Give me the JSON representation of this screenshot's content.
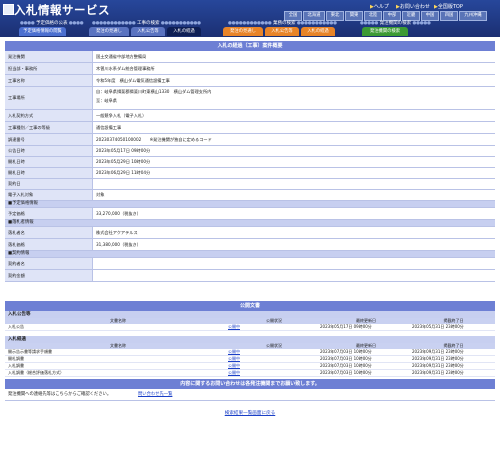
{
  "header": {
    "app_title": "入札情報サービス",
    "help": "ヘルプ",
    "contact": "お問い合わせ",
    "sitemap": "全国版TOP",
    "regions": [
      "北海道",
      "東北",
      "関東",
      "北陸",
      "中部",
      "近畿",
      "中国",
      "四国",
      "九州沖縄"
    ],
    "regions_top": [
      "全国"
    ]
  },
  "nav": {
    "groups": [
      "予定価格の公表",
      "工事の検索",
      "業務の検索",
      "発注機関の検索"
    ],
    "tabs": [
      "予定価格情報の閲覧",
      "発注の見通し",
      "入札公告等",
      "入札の経過",
      "発注の見通し",
      "入札公告等",
      "入札の経過",
      "発注機関の検索"
    ]
  },
  "detail": {
    "title": "入札の経過（工事）案件概要",
    "rows": [
      {
        "label": "発注機関",
        "value": "国土交通省中部地方整備局"
      },
      {
        "label": "担当部・事務所",
        "value": "木曽川水系ダム統合管理事務所"
      },
      {
        "label": "工事名称",
        "value": "令和5年度　横山ダム電気通信設備工事"
      },
      {
        "label": "工事場所",
        "value": "自：岐阜県揖斐郡揖斐川町東横山1330　横山ダム管理支所内"
      },
      {
        "label": "工事場所2",
        "value": "至：岐阜県"
      },
      {
        "label": "入札契約方式",
        "value": "一般競争入札（電子入札）"
      },
      {
        "label": "工事種別／工事の等級",
        "value": "通信設備工事"
      },
      {
        "label": "調達番号",
        "value": "20230374050100002　　※発注機関が独自に定めるコード"
      },
      {
        "label": "公告日時",
        "value": "2023年05月17日 09時00分"
      },
      {
        "label": "開札日時",
        "value": "2023年05月29日 10時00分"
      },
      {
        "label": "開札日時",
        "value": "2023年06月29日 11時04分"
      },
      {
        "label": "契約日",
        "value": ""
      },
      {
        "label": "電子入札対象",
        "value": "対象"
      }
    ],
    "sections": {
      "price": "予定価格情報",
      "winner": "落札者情報",
      "contract": "契約情報"
    },
    "price_rows": [
      {
        "label": "予定価格",
        "value": "33,270,000（税抜き）"
      }
    ],
    "winner_rows": [
      {
        "label": "落札者名",
        "value": "株式会社アクアテルス"
      },
      {
        "label": "落札価格",
        "value": "31,380,000（税抜き）"
      }
    ],
    "contract_rows": [
      {
        "label": "契約者名",
        "value": ""
      },
      {
        "label": "契約金額",
        "value": ""
      }
    ]
  },
  "docs": {
    "title": "公開文書",
    "section1": "入札公告等",
    "headers": [
      "文書名称",
      "公開状況",
      "最終更新日",
      "掲載終了日"
    ],
    "rows1": [
      {
        "name": "入札公告",
        "status": "公開中",
        "updated": "2023年05月17日 09時00分",
        "end": "2023年05月31日 23時00分"
      }
    ],
    "section2": "入札経過",
    "rows2": [
      {
        "name": "開示告示書等請求手順書",
        "status": "公開中",
        "updated": "2023年07月03日 10時00分",
        "end": "2023年09月31日 23時00分"
      },
      {
        "name": "開札調書",
        "status": "公開中",
        "updated": "2023年07月03日 10時00分",
        "end": "2023年09月31日 23時00分"
      },
      {
        "name": "入札調書",
        "status": "公開中",
        "updated": "2023年07月03日 10時00分",
        "end": "2023年09月31日 23時00分"
      },
      {
        "name": "入札調書（総合評価落札方式）",
        "status": "公開中",
        "updated": "2023年07月03日 10時00分",
        "end": "2023年09月31日 23時00分"
      }
    ]
  },
  "inquiry": {
    "title": "内容に関するお問い合わせは各発注機関までお願い致します。",
    "label": "発注機関への連絡先等はこちらからご確認ください。",
    "link": "問い合わせ先一覧"
  },
  "footer": {
    "back": "検索結果一覧画面に戻る"
  }
}
